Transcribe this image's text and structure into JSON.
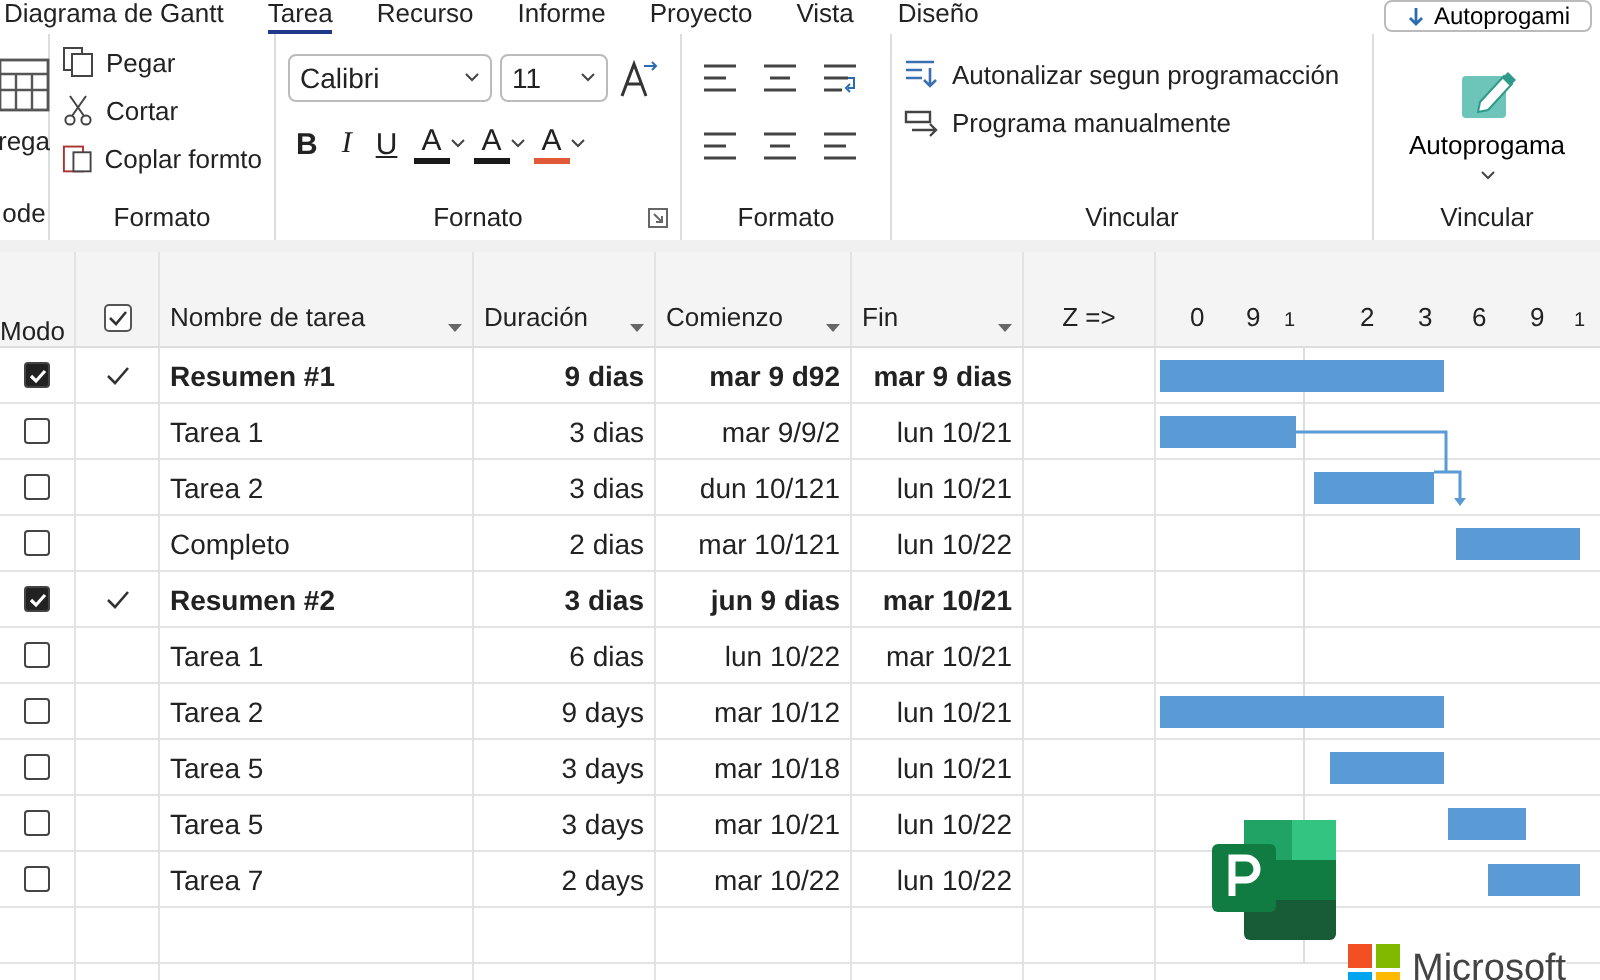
{
  "tabs": [
    {
      "label": "Diagrama de Gantt",
      "selected": false
    },
    {
      "label": "Tarea",
      "selected": true
    },
    {
      "label": "Recurso",
      "selected": false
    },
    {
      "label": "Informe",
      "selected": false
    },
    {
      "label": "Proyecto",
      "selected": false
    },
    {
      "label": "Vista",
      "selected": false
    },
    {
      "label": "Diseño",
      "selected": false
    }
  ],
  "top_button": "Autoprogami",
  "ribbon": {
    "view_group": {
      "label": "rega",
      "group_label": "ode"
    },
    "clipboard": {
      "items": [
        "Pegar",
        "Cortar",
        "Coplar formto"
      ],
      "group_label": "Formato"
    },
    "font": {
      "family": "Calibri",
      "size": "11",
      "styles": [
        "B",
        "I",
        "U"
      ],
      "colors": [
        {
          "letter": "A",
          "color": "#1a1a1a"
        },
        {
          "letter": "A",
          "color": "#1a1a1a"
        },
        {
          "letter": "A",
          "color": "#e05a3a"
        }
      ],
      "group_label": "Fornato"
    },
    "paragraph": {
      "group_label": "Formato"
    },
    "schedule": {
      "items": [
        "Autonalizar segun programacción",
        "Programa manualmente"
      ],
      "group_label": "Vincular"
    },
    "mode": {
      "button": "Autoprogama",
      "group_label": "Vincular"
    }
  },
  "table": {
    "columns": [
      "Modo",
      "Nombre de tarea",
      "Duración",
      "Comienzo",
      "Fin",
      "Z =>"
    ],
    "timescale": [
      "0",
      "9",
      "1",
      "2",
      "3",
      "6",
      "9",
      "1"
    ],
    "rows": [
      {
        "kind": "summary",
        "checked": true,
        "done": true,
        "name": "Resumen #1",
        "duration": "9 dias",
        "start": "mar 9 d92",
        "finish": "mar 9 dias"
      },
      {
        "kind": "task",
        "checked": false,
        "done": false,
        "name": "Tarea 1",
        "duration": "3 dias",
        "start": "mar 9/9/2",
        "finish": "lun 10/21"
      },
      {
        "kind": "task",
        "checked": false,
        "done": false,
        "name": "Tarea 2",
        "duration": "3 dias",
        "start": "dun 10/121",
        "finish": "lun 10/21"
      },
      {
        "kind": "task",
        "checked": false,
        "done": false,
        "name": "Completo",
        "duration": "2 dias",
        "start": "mar 10/121",
        "finish": "lun 10/22"
      },
      {
        "kind": "summary",
        "checked": true,
        "done": true,
        "name": "Resumen #2",
        "duration": "3 dias",
        "start": "jun 9 dias",
        "finish": "mar 10/21"
      },
      {
        "kind": "task",
        "checked": false,
        "done": false,
        "name": "Tarea 1",
        "duration": "6 dias",
        "start": "lun 10/22",
        "finish": "mar 10/21"
      },
      {
        "kind": "task",
        "checked": false,
        "done": false,
        "name": "Tarea 2",
        "duration": "9 days",
        "start": "mar 10/12",
        "finish": "lun 10/21"
      },
      {
        "kind": "task",
        "checked": false,
        "done": false,
        "name": "Tarea 5",
        "duration": "3 days",
        "start": "mar 10/18",
        "finish": "lun 10/21"
      },
      {
        "kind": "task",
        "checked": false,
        "done": false,
        "name": "Tarea 5",
        "duration": "3 days",
        "start": "mar 10/21",
        "finish": "lun 10/22"
      },
      {
        "kind": "task",
        "checked": false,
        "done": false,
        "name": "Tarea 7",
        "duration": "2 days",
        "start": "mar 10/22",
        "finish": "lun 10/22"
      }
    ]
  },
  "logo": {
    "text": "Microsoft"
  }
}
